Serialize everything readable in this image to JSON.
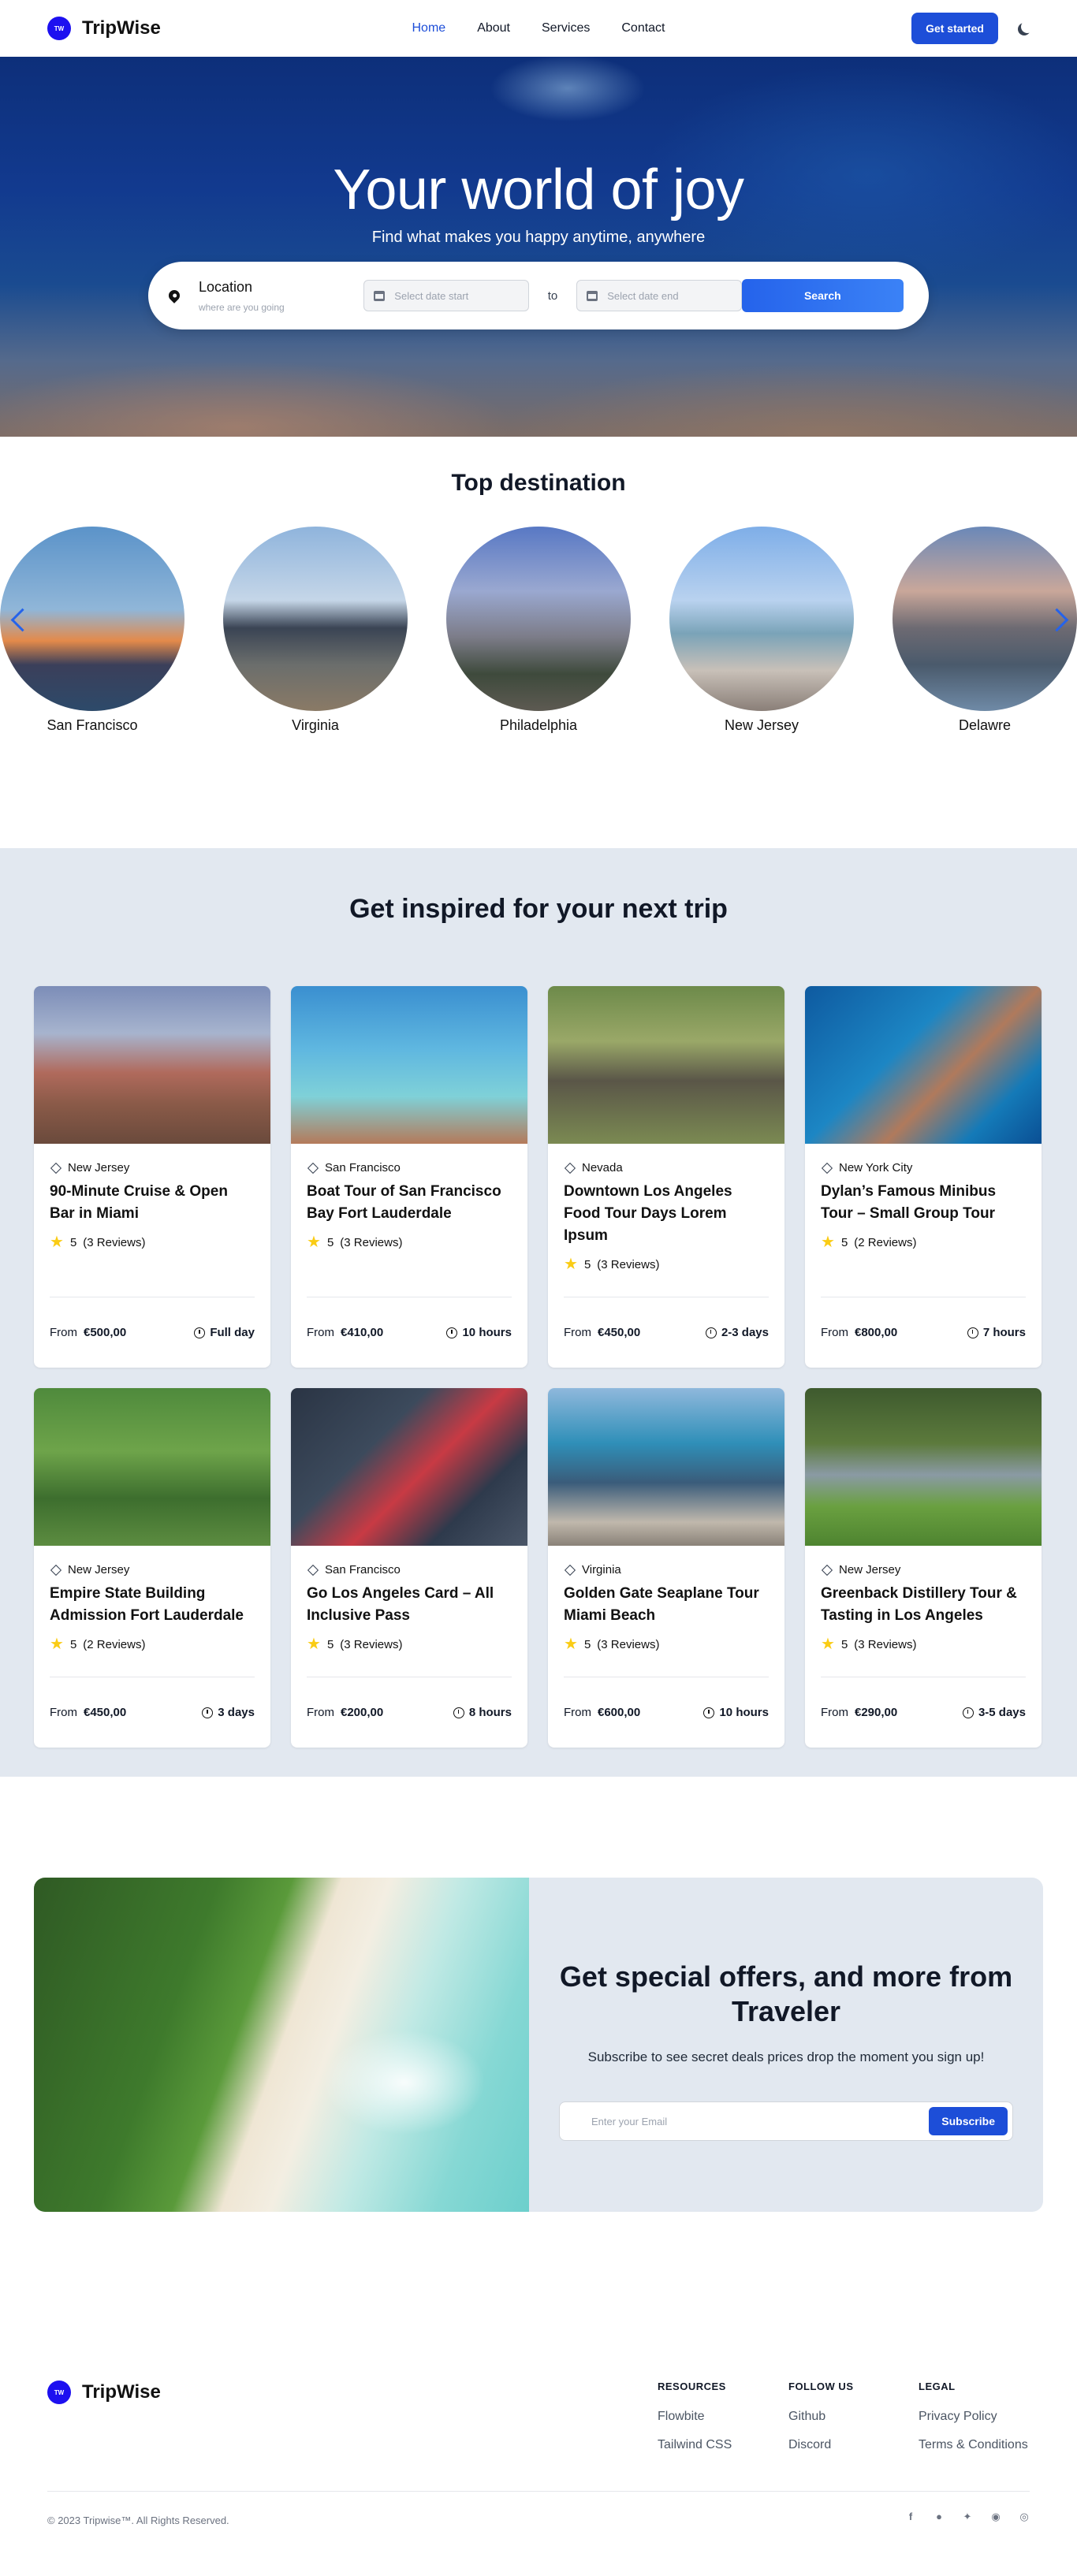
{
  "nav": {
    "logo_text": "TW",
    "brand": "TripWise",
    "links": [
      "Home",
      "About",
      "Services",
      "Contact"
    ],
    "cta": "Get started"
  },
  "hero": {
    "title": "Your world of joy",
    "subtitle": "Find what makes you happy anytime, anywhere",
    "location_label": "Location",
    "location_placeholder": "where are you going",
    "date_start_placeholder": "Select date start",
    "to_label": "to",
    "date_end_placeholder": "Select date end",
    "search_label": "Search"
  },
  "top_destination": {
    "heading": "Top destination",
    "items": [
      "San Francisco",
      "Virginia",
      "Philadelphia",
      "New Jersey",
      "Delawre"
    ]
  },
  "inspired": {
    "heading": "Get inspired for your next trip",
    "from_label": "From",
    "cards": [
      {
        "location": "New Jersey",
        "title": "90-Minute Cruise & Open Bar in Miami",
        "rating": "5",
        "reviews": "(3 Reviews)",
        "price": "€500,00",
        "duration": "Full day"
      },
      {
        "location": "San Francisco",
        "title": "Boat Tour of San Francisco Bay Fort Lauderdale",
        "rating": "5",
        "reviews": "(3 Reviews)",
        "price": "€410,00",
        "duration": "10 hours"
      },
      {
        "location": "Nevada",
        "title": "Downtown Los Angeles Food Tour Days Lorem Ipsum",
        "rating": "5",
        "reviews": "(3 Reviews)",
        "price": "€450,00",
        "duration": "2-3 days"
      },
      {
        "location": "New York City",
        "title": "Dylan’s Famous Minibus Tour – Small Group Tour",
        "rating": "5",
        "reviews": "(2 Reviews)",
        "price": "€800,00",
        "duration": "7 hours"
      },
      {
        "location": "New Jersey",
        "title": "Empire State Building Admission Fort Lauderdale",
        "rating": "5",
        "reviews": "(2 Reviews)",
        "price": "€450,00",
        "duration": "3 days"
      },
      {
        "location": "San Francisco",
        "title": "Go Los Angeles Card – All Inclusive Pass",
        "rating": "5",
        "reviews": "(3 Reviews)",
        "price": "€200,00",
        "duration": "8 hours"
      },
      {
        "location": "Virginia",
        "title": "Golden Gate Seaplane Tour Miami Beach",
        "rating": "5",
        "reviews": "(3 Reviews)",
        "price": "€600,00",
        "duration": "10 hours"
      },
      {
        "location": "New Jersey",
        "title": "Greenback Distillery Tour & Tasting in Los Angeles",
        "rating": "5",
        "reviews": "(3 Reviews)",
        "price": "€290,00",
        "duration": "3-5 days"
      }
    ]
  },
  "newsletter": {
    "title": "Get special offers, and more from Traveler",
    "subtitle": "Subscribe to see secret deals prices drop the moment you sign up!",
    "email_placeholder": "Enter your Email",
    "subscribe_label": "Subscribe"
  },
  "footer": {
    "brand": "TripWise",
    "logo_text": "TW",
    "columns": [
      {
        "heading": "RESOURCES",
        "items": [
          "Flowbite",
          "Tailwind CSS"
        ]
      },
      {
        "heading": "FOLLOW US",
        "items": [
          "Github",
          "Discord"
        ]
      },
      {
        "heading": "LEGAL",
        "items": [
          "Privacy Policy",
          "Terms & Conditions"
        ]
      }
    ],
    "copyright": "© 2023 Tripwise™. All Rights Reserved.",
    "socials": [
      "facebook-icon",
      "discord-icon",
      "twitter-icon",
      "github-icon",
      "dribbble-icon"
    ]
  },
  "colors": {
    "primary": "#1d4ed8",
    "logo": "#1d10f0",
    "section_bg": "#e2e8f0",
    "star": "#facc15"
  }
}
